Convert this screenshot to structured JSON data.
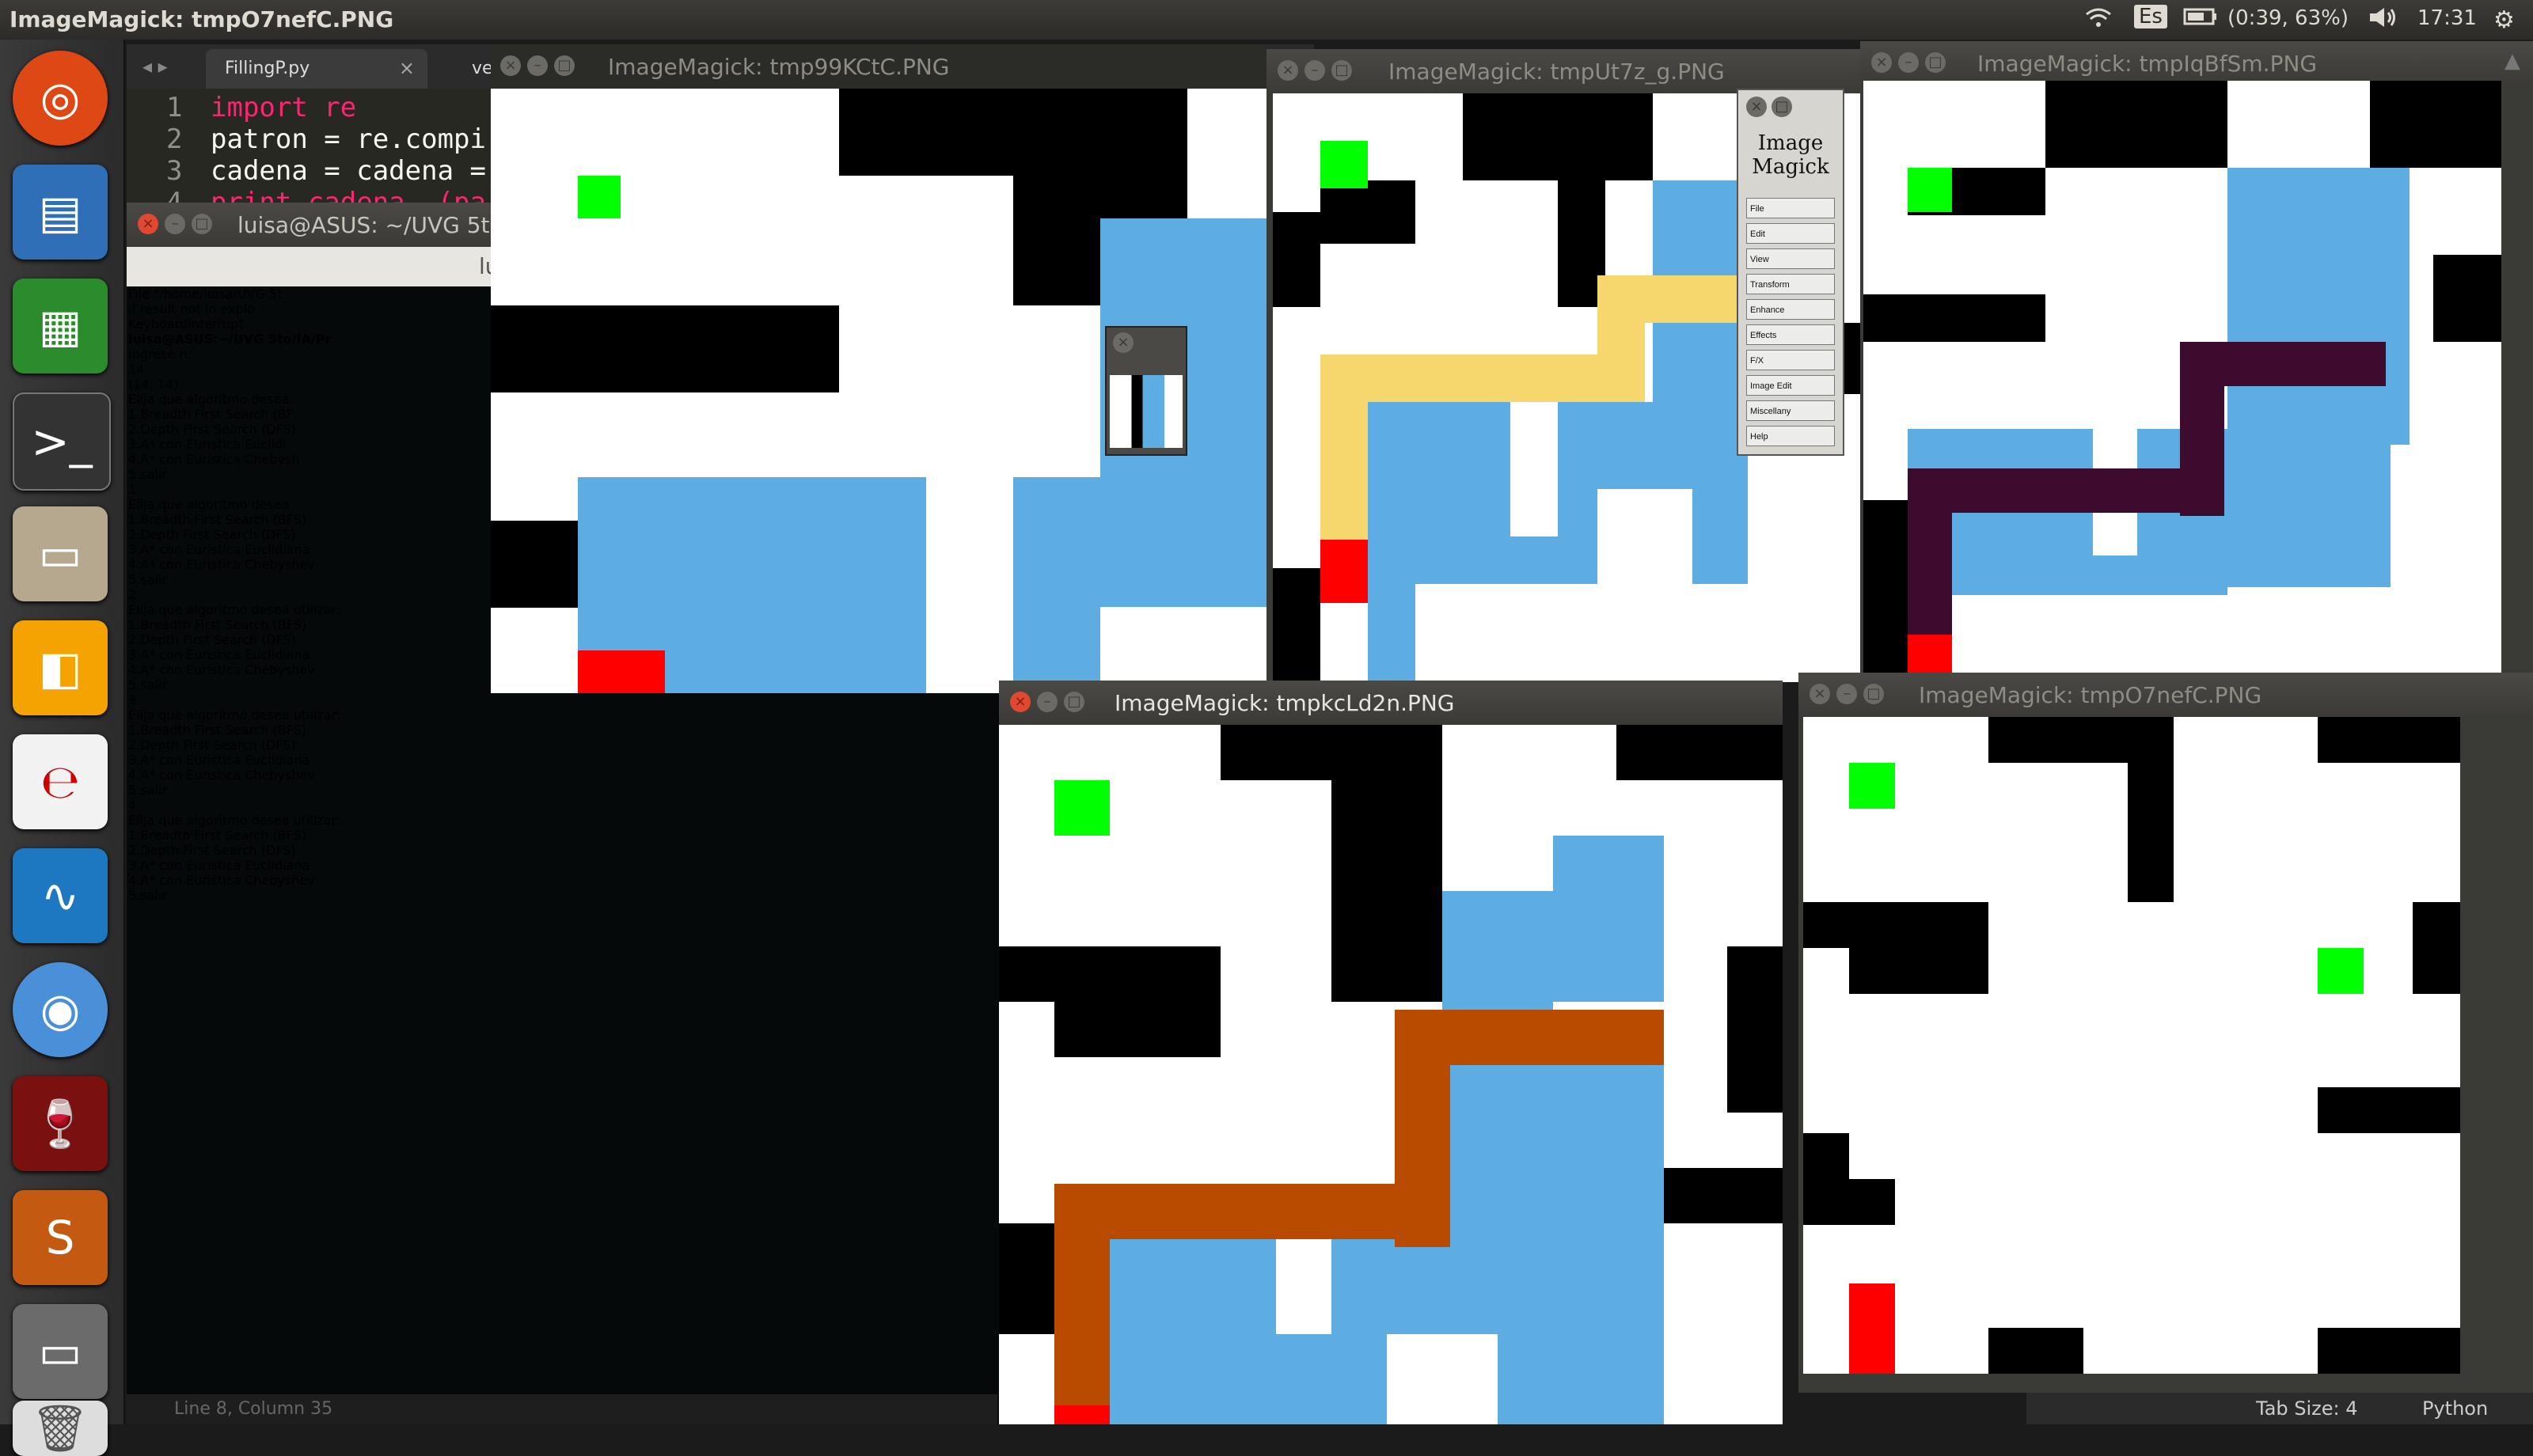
{
  "topbar": {
    "window_title": "ImageMagick: tmpO7nefC.PNG",
    "keyboard_layout": "Es",
    "battery": "(0:39, 63%)",
    "clock": "17:31"
  },
  "editor": {
    "tab_label": "FillingP.py",
    "tab2_label": "ve",
    "lines": [
      {
        "num": "1",
        "code": "import re"
      },
      {
        "num": "2",
        "code": "patron = re.compi"
      },
      {
        "num": "3",
        "code": "cadena = cadena ="
      },
      {
        "num": "4",
        "code": "print cadena, (pa"
      }
    ],
    "status_line": "Line 8, Column 35",
    "tab_size": "Tab Size: 4",
    "language": "Python"
  },
  "terminal": {
    "window_title": "luisa@ASUS: ~/UVG 5t",
    "header_title": "luisa@ASUS: ~",
    "lines": [
      "  File \"/home/luisa/UVG 5t",
      "    if result not in explo",
      "KeyboardInterrupt",
      "luisa@ASUS:~/UVG 5to/IA/Pr",
      "Ingrese n:",
      "14",
      "(14, 14)",
      "Elija que algoritmo desea",
      "1.Breadth First Search (BF",
      "2.Depth First Search (DFS)",
      "3.A* con Euristica Euclidi",
      "4.A* con Euristica Chebysh",
      "5.salir",
      "1",
      "Elija que algoritmo desea",
      "1.Breadth First Search (BFS)",
      "2.Depth First Search (DFS)",
      "3.A* con Euristica Euclidiana",
      "4.A* con Euristica Chebyshev",
      "5.salir",
      "2",
      "Elija que algoritmo desea utilizar:",
      "1.Breadth First Search (BFS)",
      "2.Depth First Search (DFS)",
      "3.A* con Euristica Euclidiana",
      "4.A* con Euristica Chebyshev",
      "5.salir",
      "3",
      "Elija que algoritmo desea utilizar:",
      "1.Breadth First Search (BFS)",
      "2.Depth First Search (DFS)",
      "3.A* con Euristica Euclidiana",
      "4.A* con Euristica Chebyshev",
      "5.salir",
      "4",
      "Elija que algoritmo desea utilizar:",
      "1.Breadth First Search (BFS)",
      "2.Depth First Search (DFS)",
      "3.A* con Euristica Euclidiana",
      "4.A* con Euristica Chebyshev",
      "5.salir"
    ]
  },
  "windows": {
    "w1": "ImageMagick: tmp99KCtC.PNG",
    "w2": "ImageMagick: tmpUt7z_g.PNG",
    "w3": "ImageMagick: tmpIqBfSm.PNG",
    "w4": "ImageMagick: tmpkcLd2n.PNG",
    "w5": "ImageMagick: tmpO7nefC.PNG"
  },
  "imagemagick_menu": {
    "logo_line1": "Image",
    "logo_line2": "Magick",
    "items": [
      "File",
      "Edit",
      "View",
      "Transform",
      "Enhance",
      "Effects",
      "F/X",
      "Image Edit",
      "Miscellany",
      "Help"
    ]
  },
  "colors": {
    "wall": "#000000",
    "free": "#ffffff",
    "start": "#00ff00",
    "goal": "#ff0000",
    "explored": "#5dade2",
    "path_dfs": "#f5d76e",
    "path_astar_euclid": "#3d0b2e",
    "path_astar_cheb": "#b94b00"
  }
}
